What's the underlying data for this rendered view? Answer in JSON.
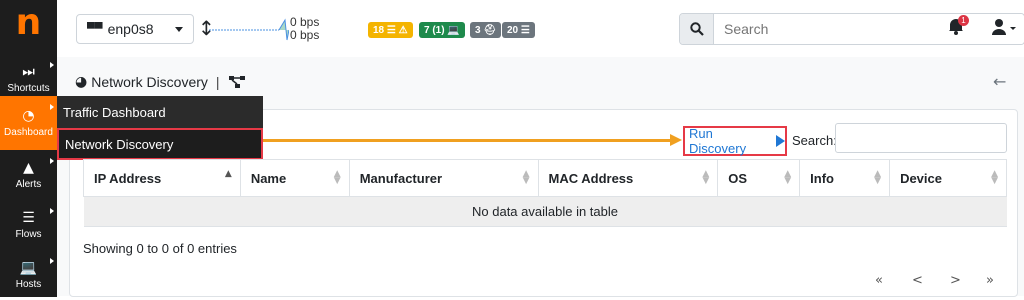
{
  "sidebar": {
    "logo": "n",
    "items": [
      {
        "label": "Shortcuts",
        "icon": "fast-forward-icon"
      },
      {
        "label": "Dashboard",
        "icon": "gauge-icon",
        "active": true
      },
      {
        "label": "Alerts",
        "icon": "warning-icon"
      },
      {
        "label": "Flows",
        "icon": "list-icon"
      },
      {
        "label": "Hosts",
        "icon": "laptop-icon"
      }
    ],
    "flyout": [
      "Traffic Dashboard",
      "Network Discovery"
    ]
  },
  "topbar": {
    "interface": "enp0s8",
    "traffic_up": "0 bps",
    "traffic_down": "0 bps",
    "badges": [
      {
        "text": "18 ☰ ⚠",
        "color": "#f4b400"
      },
      {
        "text": "7 (1) 💻",
        "color": "#1e8a4c"
      },
      {
        "text": "3 ⛑",
        "color": "#6c757d"
      },
      {
        "text": "20 ☰",
        "color": "#6c757d"
      }
    ],
    "search_placeholder": "Search",
    "notifications": "1"
  },
  "page": {
    "title": "Network Discovery",
    "separator": "|",
    "run_discovery": "Run Discovery",
    "search_label": "Search:",
    "columns": [
      "IP Address",
      "Name",
      "Manufacturer",
      "MAC Address",
      "OS",
      "Info",
      "Device"
    ],
    "empty_message": "No data available in table",
    "entries_info": "Showing 0 to 0 of 0 entries",
    "pager": [
      "«",
      "<",
      ">",
      "»"
    ]
  },
  "colors": {
    "accent": "#ff7500",
    "highlight": "#e63946",
    "arrow": "#f0a020",
    "link": "#1f77d4"
  }
}
